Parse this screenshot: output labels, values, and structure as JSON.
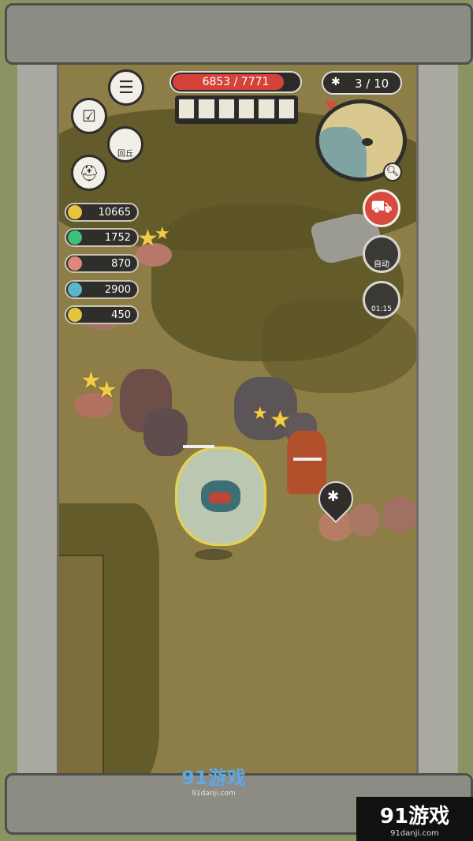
{
  "hud": {
    "boss_hp": {
      "current": 6853,
      "max": 7771,
      "text": "6853 / 7771"
    },
    "wave": {
      "text": "3 / 10"
    },
    "return_label": "回丘",
    "auto_label": "自动",
    "timer": "01:15"
  },
  "resources": [
    {
      "name": "gold",
      "value": "10665",
      "color": "#e8c43a"
    },
    {
      "name": "gem",
      "value": "1752",
      "color": "#3fc07a"
    },
    {
      "name": "bone",
      "value": "870",
      "color": "#e0867a"
    },
    {
      "name": "tooth",
      "value": "2900",
      "color": "#59b7c9"
    },
    {
      "name": "banana",
      "value": "450",
      "color": "#e3c63c"
    }
  ],
  "colors": {
    "hp_red": "#d4423a",
    "cart_red": "#d84a3f",
    "field": "#8d7e47"
  },
  "watermark": {
    "center_logo": "91游戏",
    "center_sub": "91danji.com",
    "corner_logo": "91游戏",
    "corner_sub": "91danji.com"
  }
}
